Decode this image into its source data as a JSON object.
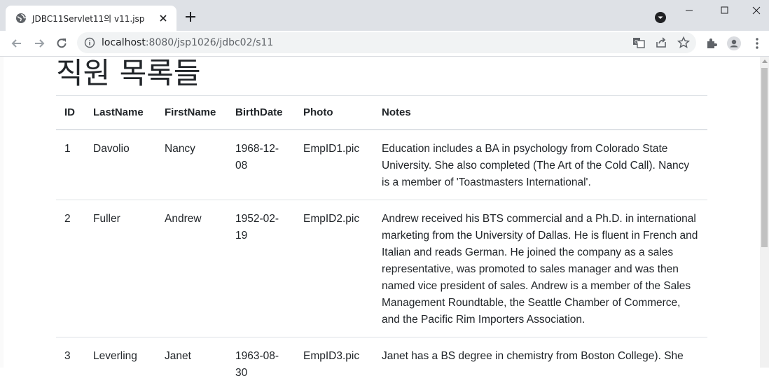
{
  "browser": {
    "tab_title": "JDBC11Servlet11의 v11.jsp",
    "url_host": "localhost",
    "url_rest": ":8080/jsp1026/jdbc02/s11"
  },
  "page": {
    "heading": "직원 목록들",
    "columns": [
      "ID",
      "LastName",
      "FirstName",
      "BirthDate",
      "Photo",
      "Notes"
    ],
    "rows": [
      {
        "id": "1",
        "last": "Davolio",
        "first": "Nancy",
        "birth": "1968-12-08",
        "photo": "EmpID1.pic",
        "notes": "Education includes a BA in psychology from Colorado State University. She also completed (The Art of the Cold Call). Nancy is a member of 'Toastmasters International'."
      },
      {
        "id": "2",
        "last": "Fuller",
        "first": "Andrew",
        "birth": "1952-02-19",
        "photo": "EmpID2.pic",
        "notes": "Andrew received his BTS commercial and a Ph.D. in international marketing from the University of Dallas. He is fluent in French and Italian and reads German. He joined the company as a sales representative, was promoted to sales manager and was then named vice president of sales. Andrew is a member of the Sales Management Roundtable, the Seattle Chamber of Commerce, and the Pacific Rim Importers Association."
      },
      {
        "id": "3",
        "last": "Leverling",
        "first": "Janet",
        "birth": "1963-08-30",
        "photo": "EmpID3.pic",
        "notes": "Janet has a BS degree in chemistry from Boston College). She"
      }
    ]
  }
}
